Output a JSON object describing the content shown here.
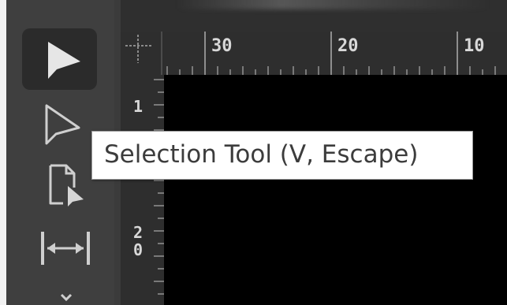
{
  "toolbar": {
    "tools": [
      {
        "icon": "selection-arrow-icon",
        "active": true
      },
      {
        "icon": "direct-selection-arrow-icon",
        "active": false
      },
      {
        "icon": "page-tool-icon",
        "active": false
      },
      {
        "icon": "gap-tool-icon",
        "active": false
      }
    ]
  },
  "ruler": {
    "horizontal_labels": [
      "30",
      "20",
      "10"
    ],
    "vertical_labels": [
      "1",
      "2",
      "0"
    ]
  },
  "tooltip": {
    "text": "Selection Tool (V, Escape)"
  },
  "colors": {
    "toolbar_bg": "#3f3f3f",
    "ruler_bg": "#2e2e2e",
    "canvas_bg": "#000000",
    "tooltip_bg": "#ffffff"
  }
}
